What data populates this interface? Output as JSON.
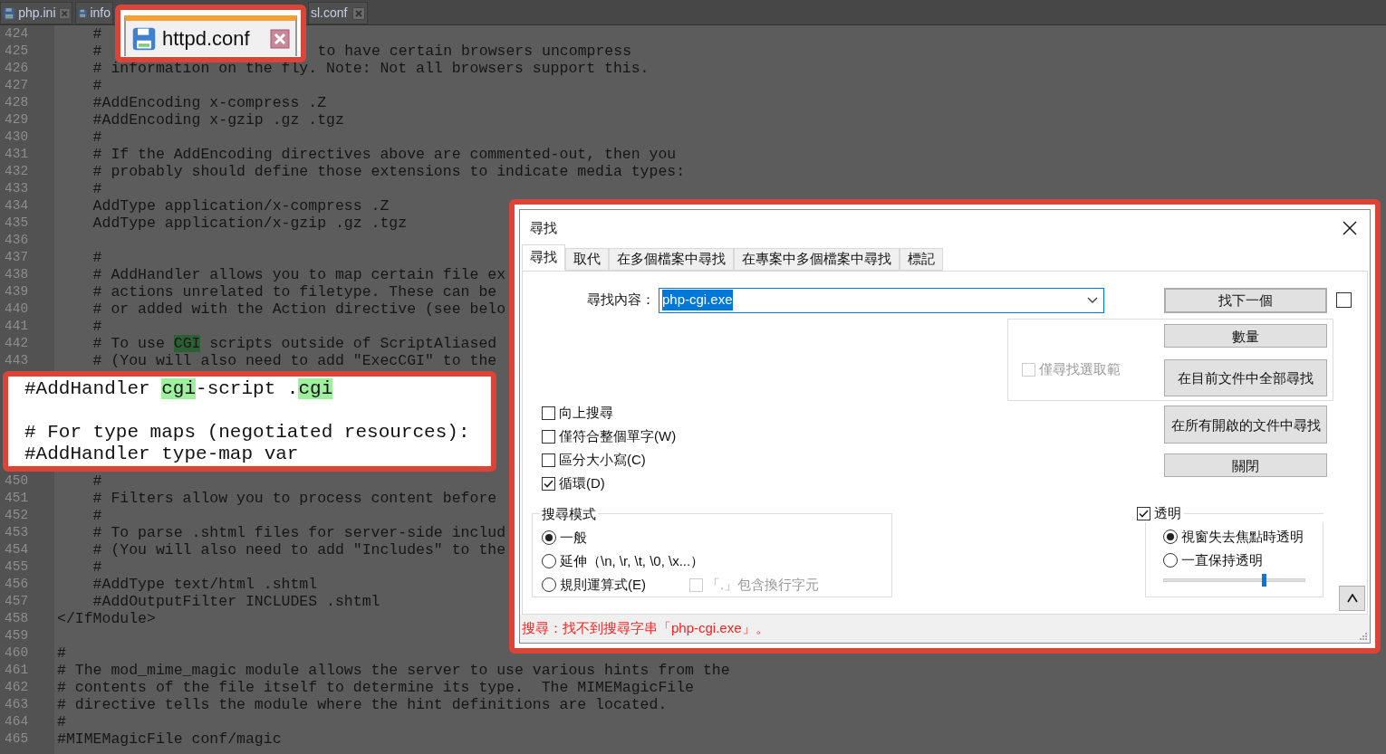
{
  "file_tabs": [
    {
      "label": "php.ini",
      "selected": false
    },
    {
      "label": "info",
      "selected": false
    },
    {
      "label": "sl.conf",
      "selected": false
    }
  ],
  "tab_callout": {
    "label": "httpd.conf",
    "selected": true
  },
  "editor": {
    "lines": [
      {
        "num": "424",
        "text": "    #"
      },
      {
        "num": "425",
        "text": "    #",
        "tail": "to have certain browsers uncompress"
      },
      {
        "num": "426",
        "text": "    # information on the fly. Note: Not all browsers support this."
      },
      {
        "num": "427",
        "text": "    #"
      },
      {
        "num": "428",
        "text": "    #AddEncoding x-compress .Z"
      },
      {
        "num": "429",
        "text": "    #AddEncoding x-gzip .gz .tgz"
      },
      {
        "num": "430",
        "text": "    #"
      },
      {
        "num": "431",
        "text": "    # If the AddEncoding directives above are commented-out, then you"
      },
      {
        "num": "432",
        "text": "    # probably should define those extensions to indicate media types:"
      },
      {
        "num": "433",
        "text": "    #"
      },
      {
        "num": "434",
        "text": "    AddType application/x-compress .Z"
      },
      {
        "num": "435",
        "text": "    AddType application/x-gzip .gz .tgz"
      },
      {
        "num": "436"
      },
      {
        "num": "437",
        "text": "    #"
      },
      {
        "num": "438",
        "text": "    # AddHandler allows you to map certain file ex"
      },
      {
        "num": "439",
        "text": "    # actions unrelated to filetype. These can be"
      },
      {
        "num": "440",
        "text": "    # or added with the Action directive (see belo"
      },
      {
        "num": "441",
        "text": "    #"
      },
      {
        "num": "442",
        "parts": [
          {
            "text": "    # To use "
          },
          {
            "text": "CGI",
            "highlighted": true
          },
          {
            "text": " scripts outside of ScriptAliased"
          }
        ]
      },
      {
        "num": "443",
        "text": "    # (You will also need to add \"ExecCGI\" to the"
      },
      {
        "num": "450",
        "text": "    #"
      },
      {
        "num": "451",
        "text": "    # Filters allow you to process content before"
      },
      {
        "num": "452",
        "text": "    #"
      },
      {
        "num": "453",
        "text": "    # To parse .shtml files for server-side includ"
      },
      {
        "num": "454",
        "text": "    # (You will also need to add \"Includes\" to the"
      },
      {
        "num": "455",
        "text": "    #"
      },
      {
        "num": "456",
        "text": "    #AddType text/html .shtml"
      },
      {
        "num": "457",
        "text": "    #AddOutputFilter INCLUDES .shtml"
      },
      {
        "num": "458",
        "text": "</IfModule>"
      },
      {
        "num": "459"
      },
      {
        "num": "460",
        "text": "#"
      },
      {
        "num": "461",
        "text": "# The mod_mime_magic module allows the server to use various hints from the"
      },
      {
        "num": "462",
        "text": "# contents of the file itself to determine its type.  The MIMEMagicFile"
      },
      {
        "num": "463",
        "text": "# directive tells the module where the hint definitions are located."
      },
      {
        "num": "464",
        "text": "#"
      },
      {
        "num": "465",
        "text": "#MIMEMagicFile conf/magic"
      }
    ]
  },
  "code_callout": {
    "lines": [
      {
        "kind": "code",
        "parts": [
          {
            "text": "#AddHandler "
          },
          {
            "text": "cgi",
            "highlighted": true
          },
          {
            "text": "-script ."
          },
          {
            "text": "cgi",
            "highlighted": true
          }
        ]
      },
      {
        "kind": "blank"
      },
      {
        "kind": "code",
        "parts": [
          {
            "text": "# For type maps (negotiated resources):"
          }
        ]
      },
      {
        "kind": "code",
        "parts": [
          {
            "text": "#AddHandler type-map var"
          }
        ]
      }
    ]
  },
  "find_dialog": {
    "title": "尋找",
    "tabs": [
      {
        "label": "尋找",
        "selected": true
      },
      {
        "label": "取代",
        "selected": false
      },
      {
        "label": "在多個檔案中尋找",
        "selected": false
      },
      {
        "label": "在專案中多個檔案中尋找",
        "selected": false
      },
      {
        "label": "標記",
        "selected": false
      }
    ],
    "find_what": {
      "label": "尋找內容：",
      "value": "php-cgi.exe",
      "text_selected": true
    },
    "find_next_button": "找下一個",
    "side_checkbox": {
      "checked": false
    },
    "in_selection": {
      "label": "僅尋找選取範",
      "checked": false,
      "disabled": true
    },
    "count_button": "數量",
    "find_all_current_button": "在目前文件中全部尋找",
    "find_all_open_button": "在所有開啟的文件中尋找",
    "close_button": "關閉",
    "options": [
      {
        "label": "向上搜尋",
        "checked": false
      },
      {
        "label": "僅符合整個單字(W)",
        "checked": false
      },
      {
        "label": "區分大小寫(C)",
        "checked": false
      },
      {
        "label": "循環(D)",
        "checked": true
      }
    ],
    "search_mode": {
      "title": "搜尋模式",
      "modes": [
        {
          "label": "一般",
          "selected": true
        },
        {
          "label": "延伸（\\n, \\r, \\t, \\0, \\x...）",
          "selected": false
        },
        {
          "label": "規則運算式(E)",
          "selected": false
        }
      ],
      "dot_matches_newline": {
        "label": "「.」包含換行字元",
        "checked": false,
        "disabled": true
      }
    },
    "transparency": {
      "label": "透明",
      "checked": true,
      "modes": [
        {
          "label": "視窗失去焦點時透明",
          "selected": true
        },
        {
          "label": "一直保持透明",
          "selected": false
        }
      ],
      "level": 0.71
    },
    "status": "搜尋：找不到搜尋字串「php-cgi.exe」。"
  }
}
